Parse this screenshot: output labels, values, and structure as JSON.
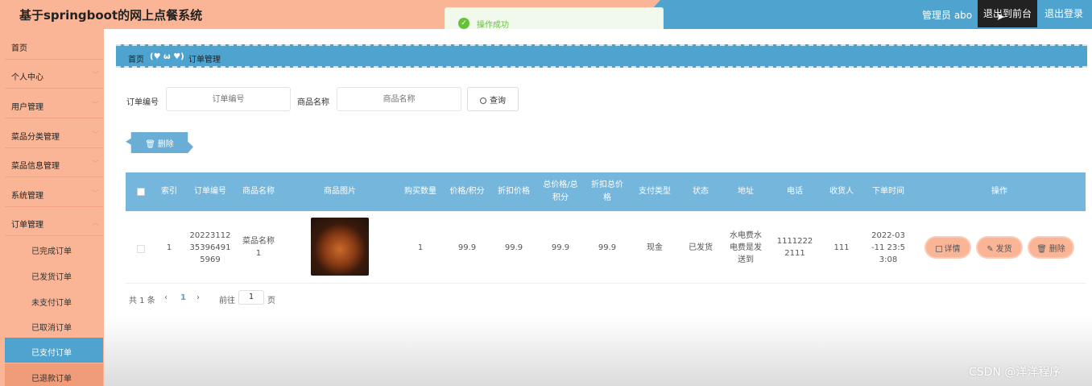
{
  "header": {
    "title": "基于springboot的网上点餐系统",
    "admin": "管理员 abo",
    "front_btn": "退出到前台",
    "logout_btn": "退出登录"
  },
  "toast": {
    "message": "操作成功"
  },
  "sidebar": {
    "items": [
      {
        "label": "首页"
      },
      {
        "label": "个人中心"
      },
      {
        "label": "用户管理"
      },
      {
        "label": "菜品分类管理"
      },
      {
        "label": "菜品信息管理"
      },
      {
        "label": "系统管理"
      },
      {
        "label": "订单管理"
      }
    ],
    "sub_items": [
      {
        "label": "已完成订单"
      },
      {
        "label": "已发货订单"
      },
      {
        "label": "未支付订单"
      },
      {
        "label": "已取消订单"
      },
      {
        "label": "已支付订单"
      },
      {
        "label": "已退款订单"
      }
    ]
  },
  "breadcrumb": {
    "home": "首页",
    "sep": "(♥ ω ♥)",
    "page": "订单管理"
  },
  "search": {
    "order_label": "订单编号",
    "order_placeholder": "订单编号",
    "product_label": "商品名称",
    "product_placeholder": "商品名称",
    "query_btn": "查询"
  },
  "toolbar": {
    "delete_btn": "删除"
  },
  "table": {
    "headers": [
      "索引",
      "订单编号",
      "商品名称",
      "商品图片",
      "购买数量",
      "价格/积分",
      "折扣价格",
      "总价格/总积分",
      "折扣总价格",
      "支付类型",
      "状态",
      "地址",
      "电话",
      "收货人",
      "下单时间",
      "操作"
    ],
    "rows": [
      {
        "index": "1",
        "order_no": "2022311235396491 5969",
        "order_no_lines": [
          "20223112",
          "35396491",
          "5969"
        ],
        "product_lines": [
          "菜品名称",
          "1"
        ],
        "qty": "1",
        "price": "99.9",
        "discount_price": "99.9",
        "total": "99.9",
        "discount_total": "99.9",
        "pay_type": "现金",
        "status": "已发货",
        "address_lines": [
          "水电费水",
          "电费是发",
          "送到"
        ],
        "phone_lines": [
          "1111222",
          "2111"
        ],
        "receiver": "111",
        "time_lines": [
          "2022-03",
          "-11 23:5",
          "3:08"
        ]
      }
    ],
    "actions": {
      "detail": "详情",
      "ship": "发货",
      "delete": "删除"
    }
  },
  "pager": {
    "total": "共 1 条",
    "prev": "‹",
    "current": "1",
    "next": "›",
    "goto": "前往",
    "page_value": "1",
    "page_unit": "页"
  },
  "watermark": "CSDN @洋洋程序"
}
